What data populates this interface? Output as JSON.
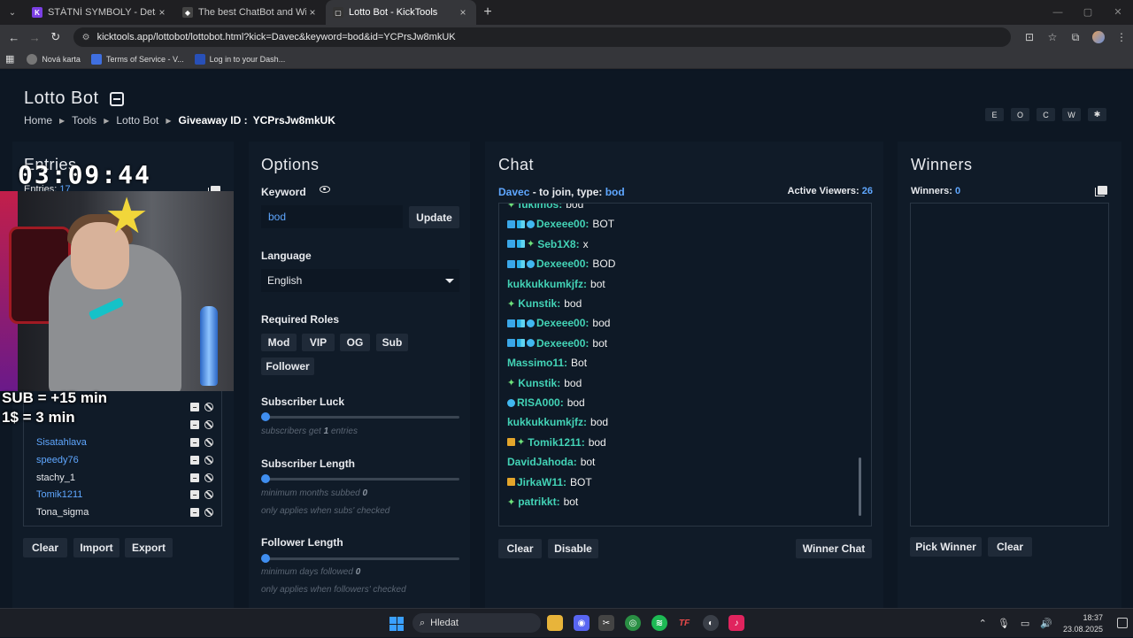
{
  "browser": {
    "tabs": [
      {
        "title": "STÁTNÍ SYMBOLY - Details - Kal",
        "icon": "K",
        "color": "#7b3fe4"
      },
      {
        "title": "The best ChatBot and Widgets",
        "icon": "◆",
        "color": "#444"
      },
      {
        "title": "Lotto Bot - KickTools",
        "icon": "▢",
        "color": "#333"
      }
    ],
    "url": "kicktools.app/lottobot/lottobot.html?kick=Davec&keyword=bod&id=YCPrsJw8mkUK",
    "bookmarks": [
      "Nová karta",
      "Terms of Service - V...",
      "Log in to your Dash..."
    ]
  },
  "header": {
    "title": "Lotto Bot",
    "breadcrumb": [
      "Home",
      "Tools",
      "Lotto Bot"
    ],
    "giveaway_label": "Giveaway ID :",
    "giveaway_id": "YCPrsJw8mkUK",
    "side_buttons": [
      "E",
      "O",
      "C",
      "W",
      "✱"
    ]
  },
  "entries": {
    "title": "Entries",
    "count_label": "Entries:",
    "count": "17",
    "items": [
      {
        "name": "Sisatahlava",
        "blue": true
      },
      {
        "name": "speedy76",
        "blue": true
      },
      {
        "name": "stachy_1",
        "blue": false
      },
      {
        "name": "Tomik1211",
        "blue": true
      },
      {
        "name": "Tona_sigma",
        "blue": false
      }
    ],
    "buttons": {
      "clear": "Clear",
      "import": "Import",
      "export": "Export"
    }
  },
  "overlay": {
    "timer": "03:09:44",
    "sub_line": "SUB = +15 min",
    "dollar_line": "1$ = 3 min"
  },
  "options": {
    "title": "Options",
    "keyword_label": "Keyword",
    "keyword_value": "bod",
    "update": "Update",
    "language_label": "Language",
    "language_value": "English",
    "roles_label": "Required Roles",
    "roles": [
      "Mod",
      "VIP",
      "OG",
      "Sub",
      "Follower"
    ],
    "sub_luck_label": "Subscriber Luck",
    "sub_luck_hint_pre": "subscribers get",
    "sub_luck_value": "1",
    "sub_luck_hint_post": "entries",
    "sub_length_label": "Subscriber Length",
    "sub_length_hint": "minimum months subbed",
    "sub_length_value": "0",
    "sub_length_note": "only applies when subs' checked",
    "fol_length_label": "Follower Length",
    "fol_length_hint": "minimum days followed",
    "fol_length_value": "0",
    "fol_length_note": "only applies when followers' checked"
  },
  "chat": {
    "title": "Chat",
    "channel": "Davec",
    "join_text": "- to join, type:",
    "keyword": "bod",
    "viewers_label": "Active Viewers:",
    "viewers": "26",
    "messages": [
      {
        "badges": [
          "spark"
        ],
        "user": "fukimos",
        "text": "bod"
      },
      {
        "badges": [
          "verified",
          "grid",
          "gem"
        ],
        "user": "Dexeee00",
        "text": "BOT"
      },
      {
        "badges": [
          "verified",
          "grid",
          "spark"
        ],
        "user": "Seb1X8",
        "text": "x"
      },
      {
        "badges": [
          "verified",
          "grid",
          "gem"
        ],
        "user": "Dexeee00",
        "text": "BOD"
      },
      {
        "badges": [],
        "user": "kukkukkumkjfz",
        "text": "bot"
      },
      {
        "badges": [
          "spark"
        ],
        "user": "Kunstik",
        "text": "bod"
      },
      {
        "badges": [
          "verified",
          "grid",
          "gem"
        ],
        "user": "Dexeee00",
        "text": "bod"
      },
      {
        "badges": [
          "verified",
          "grid",
          "gem"
        ],
        "user": "Dexeee00",
        "text": "bot"
      },
      {
        "badges": [],
        "user": "Massimo11",
        "text": "Bot"
      },
      {
        "badges": [
          "spark"
        ],
        "user": "Kunstik",
        "text": "bod"
      },
      {
        "badges": [
          "gem"
        ],
        "user": "RISA000",
        "text": "bod"
      },
      {
        "badges": [],
        "user": "kukkukkumkjfz",
        "text": "bod"
      },
      {
        "badges": [
          "crown",
          "spark"
        ],
        "user": "Tomik1211",
        "text": "bod"
      },
      {
        "badges": [],
        "user": "DavidJahoda",
        "text": "bot"
      },
      {
        "badges": [
          "crown"
        ],
        "user": "JirkaW11",
        "text": "BOT"
      },
      {
        "badges": [
          "spark"
        ],
        "user": "patrikkt",
        "text": "bot"
      }
    ],
    "buttons": {
      "clear": "Clear",
      "disable": "Disable",
      "winner_chat": "Winner Chat"
    }
  },
  "winners": {
    "title": "Winners",
    "count_label": "Winners:",
    "count": "0",
    "buttons": {
      "pick": "Pick Winner",
      "clear": "Clear"
    }
  },
  "taskbar": {
    "search_placeholder": "Hledat",
    "time": "18:37",
    "date": "23.08.2025"
  }
}
